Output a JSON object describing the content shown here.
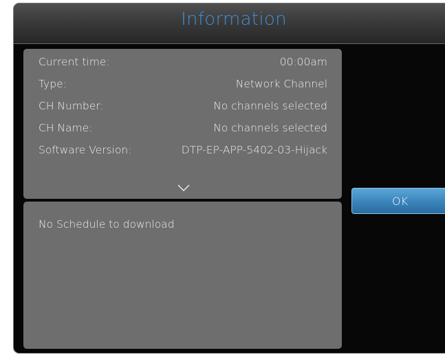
{
  "dialog": {
    "title": "Information"
  },
  "info": {
    "rows": [
      {
        "label": "Current time:",
        "value": "00:00am"
      },
      {
        "label": "Type:",
        "value": "Network Channel"
      },
      {
        "label": "CH Number:",
        "value": "No channels selected"
      },
      {
        "label": "CH Name:",
        "value": "No channels selected"
      },
      {
        "label": "Software Version:",
        "value": "DTP-EP-APP-5402-03-Hijack"
      }
    ],
    "scroll_icon": "chevron-down-icon"
  },
  "schedule": {
    "message": "No Schedule to download"
  },
  "buttons": {
    "ok_label": "OK"
  },
  "colors": {
    "title": "#3f8fd8",
    "panel": "#6e6e6e",
    "button": "#3c86bd",
    "background": "#070707"
  }
}
